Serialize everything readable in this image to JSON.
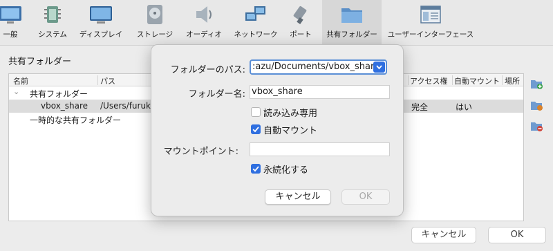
{
  "toolbar": {
    "items": [
      {
        "label": "一般",
        "icon": "monitor-icon"
      },
      {
        "label": "システム",
        "icon": "chip-icon"
      },
      {
        "label": "ディスプレイ",
        "icon": "display-icon"
      },
      {
        "label": "ストレージ",
        "icon": "hard-disk-icon"
      },
      {
        "label": "オーディオ",
        "icon": "speaker-icon"
      },
      {
        "label": "ネットワーク",
        "icon": "network-icon"
      },
      {
        "label": "ポート",
        "icon": "port-plug-icon"
      },
      {
        "label": "共有フォルダー",
        "icon": "folder-icon"
      },
      {
        "label": "ユーザーインターフェース",
        "icon": "window-layout-icon"
      }
    ],
    "active_index": 7
  },
  "panel": {
    "title": "共有フォルダー",
    "columns": [
      "名前",
      "パス",
      "アクセス権",
      "自動マウント",
      "場所"
    ],
    "machine_group": "共有フォルダー",
    "transient_group": "一時的な共有フォルダー",
    "row": {
      "name": "vbox_share",
      "path": "/Users/furuk",
      "access": "完全",
      "auto_mount": "はい"
    }
  },
  "footer": {
    "cancel_label": "キャンセル",
    "ok_label": "OK"
  },
  "dialog": {
    "path_label": "フォルダーのパス:",
    "path_value": ":azu/Documents/vbox_share",
    "name_label": "フォルダー名:",
    "name_value": "vbox_share",
    "readonly_label": "読み込み専用",
    "readonly_checked": false,
    "automount_label": "自動マウント",
    "automount_checked": true,
    "mountpoint_label": "マウントポイント:",
    "mountpoint_value": "",
    "permanent_label": "永続化する",
    "permanent_checked": true,
    "cancel_label": "キャンセル",
    "ok_label": "OK"
  },
  "colors": {
    "accent": "#2f6fe0",
    "focus_ring": "#5b8fd6",
    "selected_row": "#dcdcdc"
  }
}
